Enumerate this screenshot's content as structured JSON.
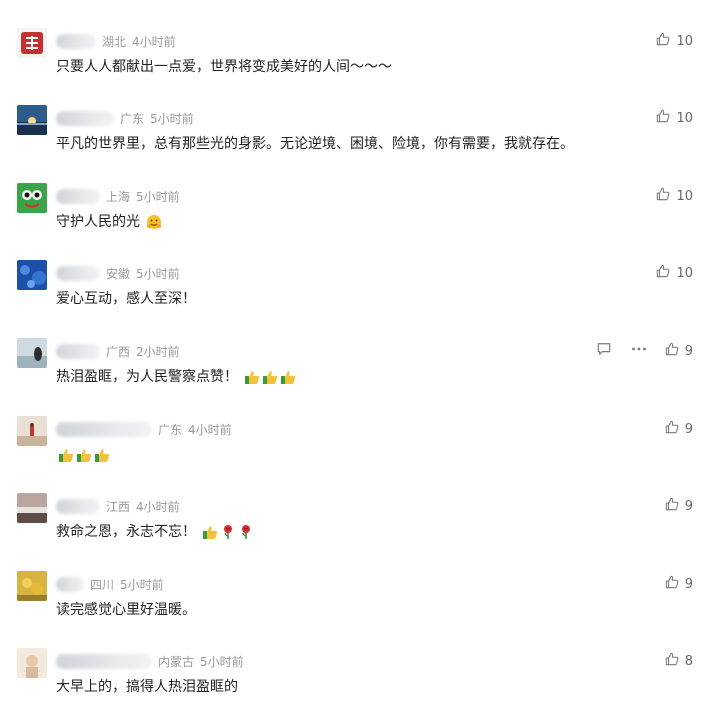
{
  "comments": [
    {
      "location": "湖北",
      "time": "4小时前",
      "text": "只要人人都献出一点爱，世界将变成美好的人间～～～",
      "likes": "10",
      "avatar": "red-seal",
      "name_width": 40
    },
    {
      "location": "广东",
      "time": "5小时前",
      "text": "平凡的世界里，总有那些光的身影。无论逆境、困境、险境，你有需要，我就存在。",
      "likes": "10",
      "avatar": "sunset-sea",
      "name_width": 58
    },
    {
      "location": "上海",
      "time": "5小时前",
      "text": "守护人民的光",
      "likes": "10",
      "avatar": "green-frog",
      "name_width": 44,
      "emojis": [
        "hug-emoji"
      ]
    },
    {
      "location": "安徽",
      "time": "5小时前",
      "text": "爱心互动，感人至深！",
      "likes": "10",
      "avatar": "blue-sea",
      "name_width": 44
    },
    {
      "location": "广西",
      "time": "2小时前",
      "text": "热泪盈眶，为人民警察点赞！",
      "likes": "9",
      "avatar": "lake-person",
      "name_width": 44,
      "emojis": [
        "thumbs-up-emoji",
        "thumbs-up-emoji",
        "thumbs-up-emoji"
      ],
      "hover": true
    },
    {
      "location": "广东",
      "time": "4小时前",
      "text": "",
      "likes": "9",
      "avatar": "desert-person",
      "name_width": 96,
      "emojis": [
        "thumbs-up-emoji",
        "thumbs-up-emoji",
        "thumbs-up-emoji"
      ]
    },
    {
      "location": "江西",
      "time": "4小时前",
      "text": "救命之恩，永志不忘！",
      "likes": "9",
      "avatar": "river-landscape",
      "name_width": 44,
      "emojis": [
        "thumbs-up-emoji",
        "rose-emoji",
        "rose-emoji"
      ]
    },
    {
      "location": "四川",
      "time": "5小时前",
      "text": "读完感觉心里好温暖。",
      "likes": "9",
      "avatar": "yellow-flowers",
      "name_width": 28
    },
    {
      "location": "内蒙古",
      "time": "5小时前",
      "text": "大早上的，搞得人热泪盈眶的",
      "likes": "8",
      "avatar": "pale-girl",
      "name_width": 96
    }
  ],
  "icons": {
    "like": "thumbs-up-outline-icon",
    "reply": "comment-bubble-icon",
    "more": "more-dots-icon"
  },
  "colors": {
    "text": "#222222",
    "meta": "#999999",
    "like": "#666666"
  }
}
